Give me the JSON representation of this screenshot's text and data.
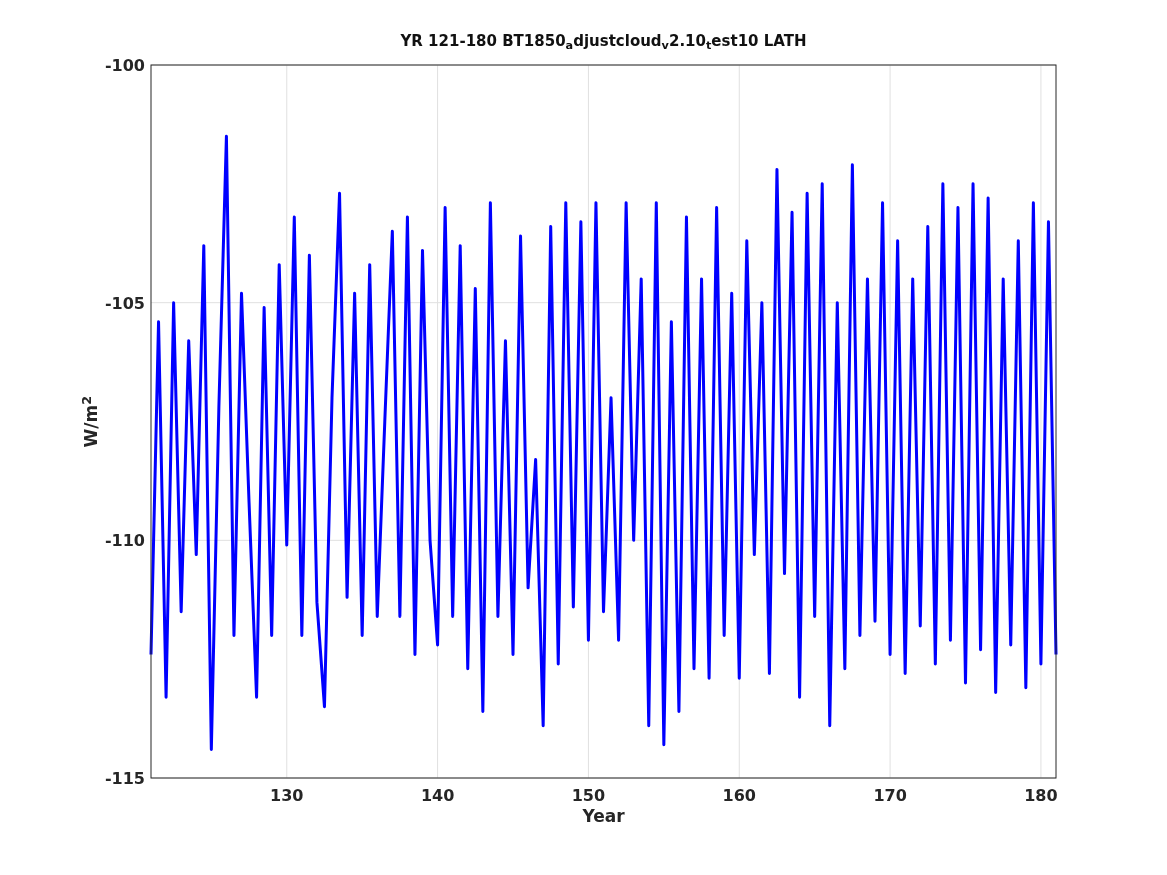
{
  "figure": {
    "chart_data": {
      "type": "line",
      "title": "YR 121-180 BT1850$_{a}$djustcloud$_{v}$2.10$_{t}$est10 LATH",
      "xlabel": "Year",
      "ylabel": "W/m$^{2}$",
      "xlim": [
        121,
        181
      ],
      "ylim": [
        -115,
        -100
      ],
      "xticks": [
        130,
        140,
        150,
        160,
        170,
        180
      ],
      "yticks": [
        -115,
        -110,
        -105,
        -100
      ],
      "grid": true,
      "x": [
        121,
        121.5,
        122,
        122.5,
        123,
        123.5,
        124,
        124.5,
        125,
        125.5,
        126,
        126.5,
        127,
        127.5,
        128,
        128.5,
        129,
        129.5,
        130,
        130.5,
        131,
        131.5,
        132,
        132.5,
        133,
        133.5,
        134,
        134.5,
        135,
        135.5,
        136,
        136.5,
        137,
        137.5,
        138,
        138.5,
        139,
        139.5,
        140,
        140.5,
        141,
        141.5,
        142,
        142.5,
        143,
        143.5,
        144,
        144.5,
        145,
        145.5,
        146,
        146.5,
        147,
        147.5,
        148,
        148.5,
        149,
        149.5,
        150,
        150.5,
        151,
        151.5,
        152,
        152.5,
        153,
        153.5,
        154,
        154.5,
        155,
        155.5,
        156,
        156.5,
        157,
        157.5,
        158,
        158.5,
        159,
        159.5,
        160,
        160.5,
        161,
        161.5,
        162,
        162.5,
        163,
        163.5,
        164,
        164.5,
        165,
        165.5,
        166,
        166.5,
        167,
        167.5,
        168,
        168.5,
        169,
        169.5,
        170,
        170.5,
        171,
        171.5,
        172,
        172.5,
        173,
        173.5,
        174,
        174.5,
        175,
        175.5,
        176,
        176.5,
        177,
        177.5,
        178,
        178.5,
        179,
        179.5,
        180,
        180.5,
        181
      ],
      "series": [
        {
          "color": "#0000ff",
          "values": [
            -112.4,
            -105.4,
            -113.3,
            -105.0,
            -111.5,
            -105.8,
            -110.3,
            -103.8,
            -114.4,
            -107.2,
            -101.5,
            -112.0,
            -104.8,
            -109.2,
            -113.3,
            -105.1,
            -112.0,
            -104.2,
            -110.1,
            -103.2,
            -112.0,
            -104.0,
            -111.3,
            -113.5,
            -107.0,
            -102.7,
            -111.2,
            -104.8,
            -112.0,
            -104.2,
            -111.6,
            -107.5,
            -103.5,
            -111.6,
            -103.2,
            -112.4,
            -103.9,
            -110.0,
            -112.2,
            -103.0,
            -111.6,
            -103.8,
            -112.7,
            -104.7,
            -113.6,
            -102.9,
            -111.6,
            -105.8,
            -112.4,
            -103.6,
            -111.0,
            -108.3,
            -113.9,
            -103.4,
            -112.6,
            -102.9,
            -111.4,
            -103.3,
            -112.1,
            -102.9,
            -111.5,
            -107.0,
            -112.1,
            -102.9,
            -110.0,
            -104.5,
            -113.9,
            -102.9,
            -114.3,
            -105.4,
            -113.6,
            -103.2,
            -112.7,
            -104.5,
            -112.9,
            -103.0,
            -112.0,
            -104.8,
            -112.9,
            -103.7,
            -110.3,
            -105.0,
            -112.8,
            -102.2,
            -110.7,
            -103.1,
            -113.3,
            -102.7,
            -111.6,
            -102.5,
            -113.9,
            -105.0,
            -112.7,
            -102.1,
            -112.0,
            -104.5,
            -111.7,
            -102.9,
            -112.4,
            -103.7,
            -112.8,
            -104.5,
            -111.8,
            -103.4,
            -112.6,
            -102.5,
            -112.1,
            -103.0,
            -113.0,
            -102.5,
            -112.3,
            -102.8,
            -113.2,
            -104.5,
            -112.2,
            -103.7,
            -113.1,
            -102.9,
            -112.6,
            -103.3,
            -112.4
          ]
        }
      ]
    }
  }
}
